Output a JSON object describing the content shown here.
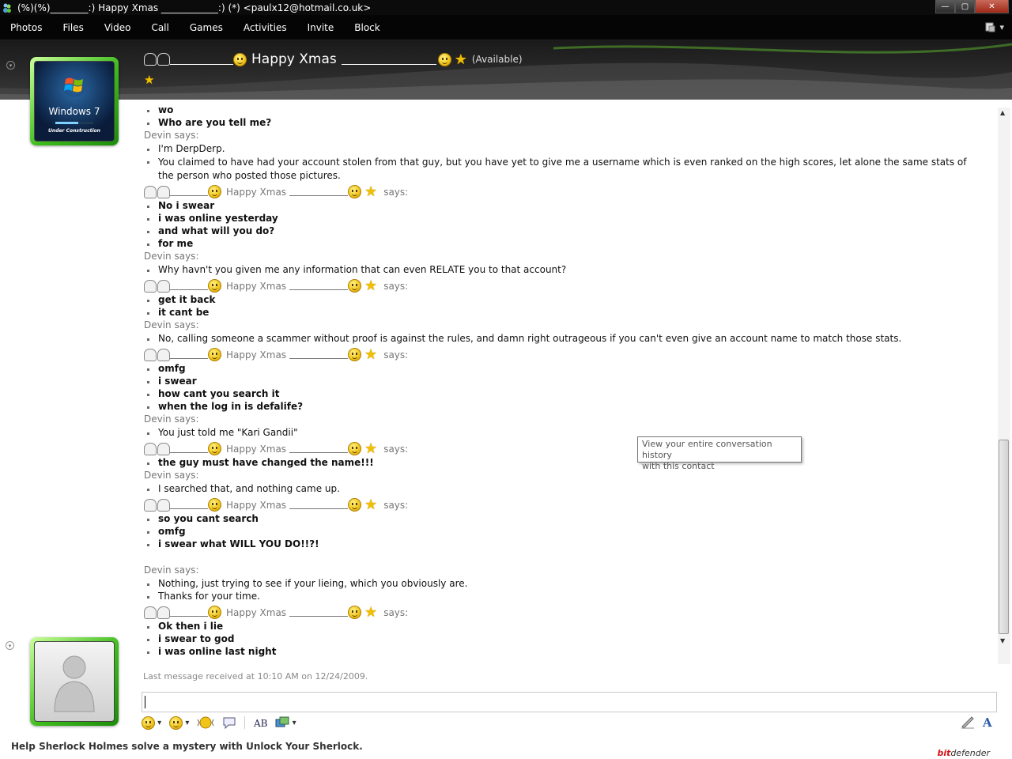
{
  "window": {
    "title": "(%)(%)________:) Happy Xmas ____________:) (*) <paulx12@hotmail.co.uk>",
    "controls": {
      "minimize": "—",
      "maximize": "▢",
      "close": "✕"
    }
  },
  "menu": {
    "items": [
      "Photos",
      "Files",
      "Video",
      "Call",
      "Games",
      "Activities",
      "Invite",
      "Block"
    ],
    "right_arrow": "▾"
  },
  "contact": {
    "name": "Happy Xmas",
    "status": "(Available)",
    "avatar_label": "Windows 7",
    "avatar_sub": "Under Construction"
  },
  "conversation": {
    "me_label": "Happy Xmas",
    "says": "says:",
    "devin_says": "Devin says:",
    "lines": [
      {
        "kind": "msg",
        "bold": true,
        "text": "wo"
      },
      {
        "kind": "msg",
        "bold": true,
        "text": "Who are you tell me?"
      },
      {
        "kind": "devin"
      },
      {
        "kind": "msg",
        "bold": false,
        "text": "I'm DerpDerp."
      },
      {
        "kind": "msg",
        "bold": false,
        "wrap": true,
        "text": "You claimed to have had your account stolen from that guy, but you have yet to give me a username which is even ranked on the high scores, let alone the same stats of the person who posted those pictures."
      },
      {
        "kind": "me"
      },
      {
        "kind": "msg",
        "bold": true,
        "text": "No i swear"
      },
      {
        "kind": "msg",
        "bold": true,
        "text": "i was online yesterday"
      },
      {
        "kind": "msg",
        "bold": true,
        "text": "and what will you do?"
      },
      {
        "kind": "msg",
        "bold": true,
        "text": "for me"
      },
      {
        "kind": "devin"
      },
      {
        "kind": "msg",
        "bold": false,
        "text": "Why havn't you given me any information that can even RELATE you to that account?"
      },
      {
        "kind": "me"
      },
      {
        "kind": "msg",
        "bold": true,
        "text": "get it back"
      },
      {
        "kind": "msg",
        "bold": true,
        "text": "it cant be"
      },
      {
        "kind": "devin"
      },
      {
        "kind": "msg",
        "bold": false,
        "text": "No, calling someone a scammer without proof is against the rules, and damn right outrageous if you can't even give an account name to match those stats."
      },
      {
        "kind": "me"
      },
      {
        "kind": "msg",
        "bold": true,
        "text": "omfg"
      },
      {
        "kind": "msg",
        "bold": true,
        "text": "i swear"
      },
      {
        "kind": "msg",
        "bold": true,
        "text": "how cant you search it"
      },
      {
        "kind": "msg",
        "bold": true,
        "text": "when the log in is defalife?"
      },
      {
        "kind": "devin"
      },
      {
        "kind": "msg",
        "bold": false,
        "text": "You just told me \"Kari Gandii\""
      },
      {
        "kind": "me"
      },
      {
        "kind": "msg",
        "bold": true,
        "text": "the guy must have changed the name!!!"
      },
      {
        "kind": "devin"
      },
      {
        "kind": "msg",
        "bold": false,
        "text": "I searched that, and nothing came up."
      },
      {
        "kind": "me"
      },
      {
        "kind": "msg",
        "bold": true,
        "text": "so you cant search"
      },
      {
        "kind": "msg",
        "bold": true,
        "text": "omfg"
      },
      {
        "kind": "msg",
        "bold": true,
        "text": "i swear what WILL YOU DO!!?!"
      },
      {
        "kind": "gap"
      },
      {
        "kind": "devin"
      },
      {
        "kind": "msg",
        "bold": false,
        "text": "Nothing, just trying to see if your lieing, which you obviously are."
      },
      {
        "kind": "msg",
        "bold": false,
        "text": "Thanks for your time."
      },
      {
        "kind": "me"
      },
      {
        "kind": "msg",
        "bold": true,
        "text": "Ok then i lie"
      },
      {
        "kind": "msg",
        "bold": true,
        "text": "i swear to god"
      },
      {
        "kind": "msg",
        "bold": true,
        "text": "i was online last night"
      }
    ],
    "last_message": "Last message received at 10:10 AM on 12/24/2009."
  },
  "tooltip": {
    "line1": "View your entire conversation history",
    "line2": "with this contact"
  },
  "input": {
    "value": ""
  },
  "status_bar": {
    "ad_text": "Help Sherlock Holmes solve a mystery with Unlock Your Sherlock.",
    "brand_prefix": "bit",
    "brand_suffix": "defender"
  },
  "icons": {
    "bell": "bell-icon",
    "smile": "smile-icon",
    "star": "star-icon",
    "accent_green": "#3dbb1c"
  }
}
